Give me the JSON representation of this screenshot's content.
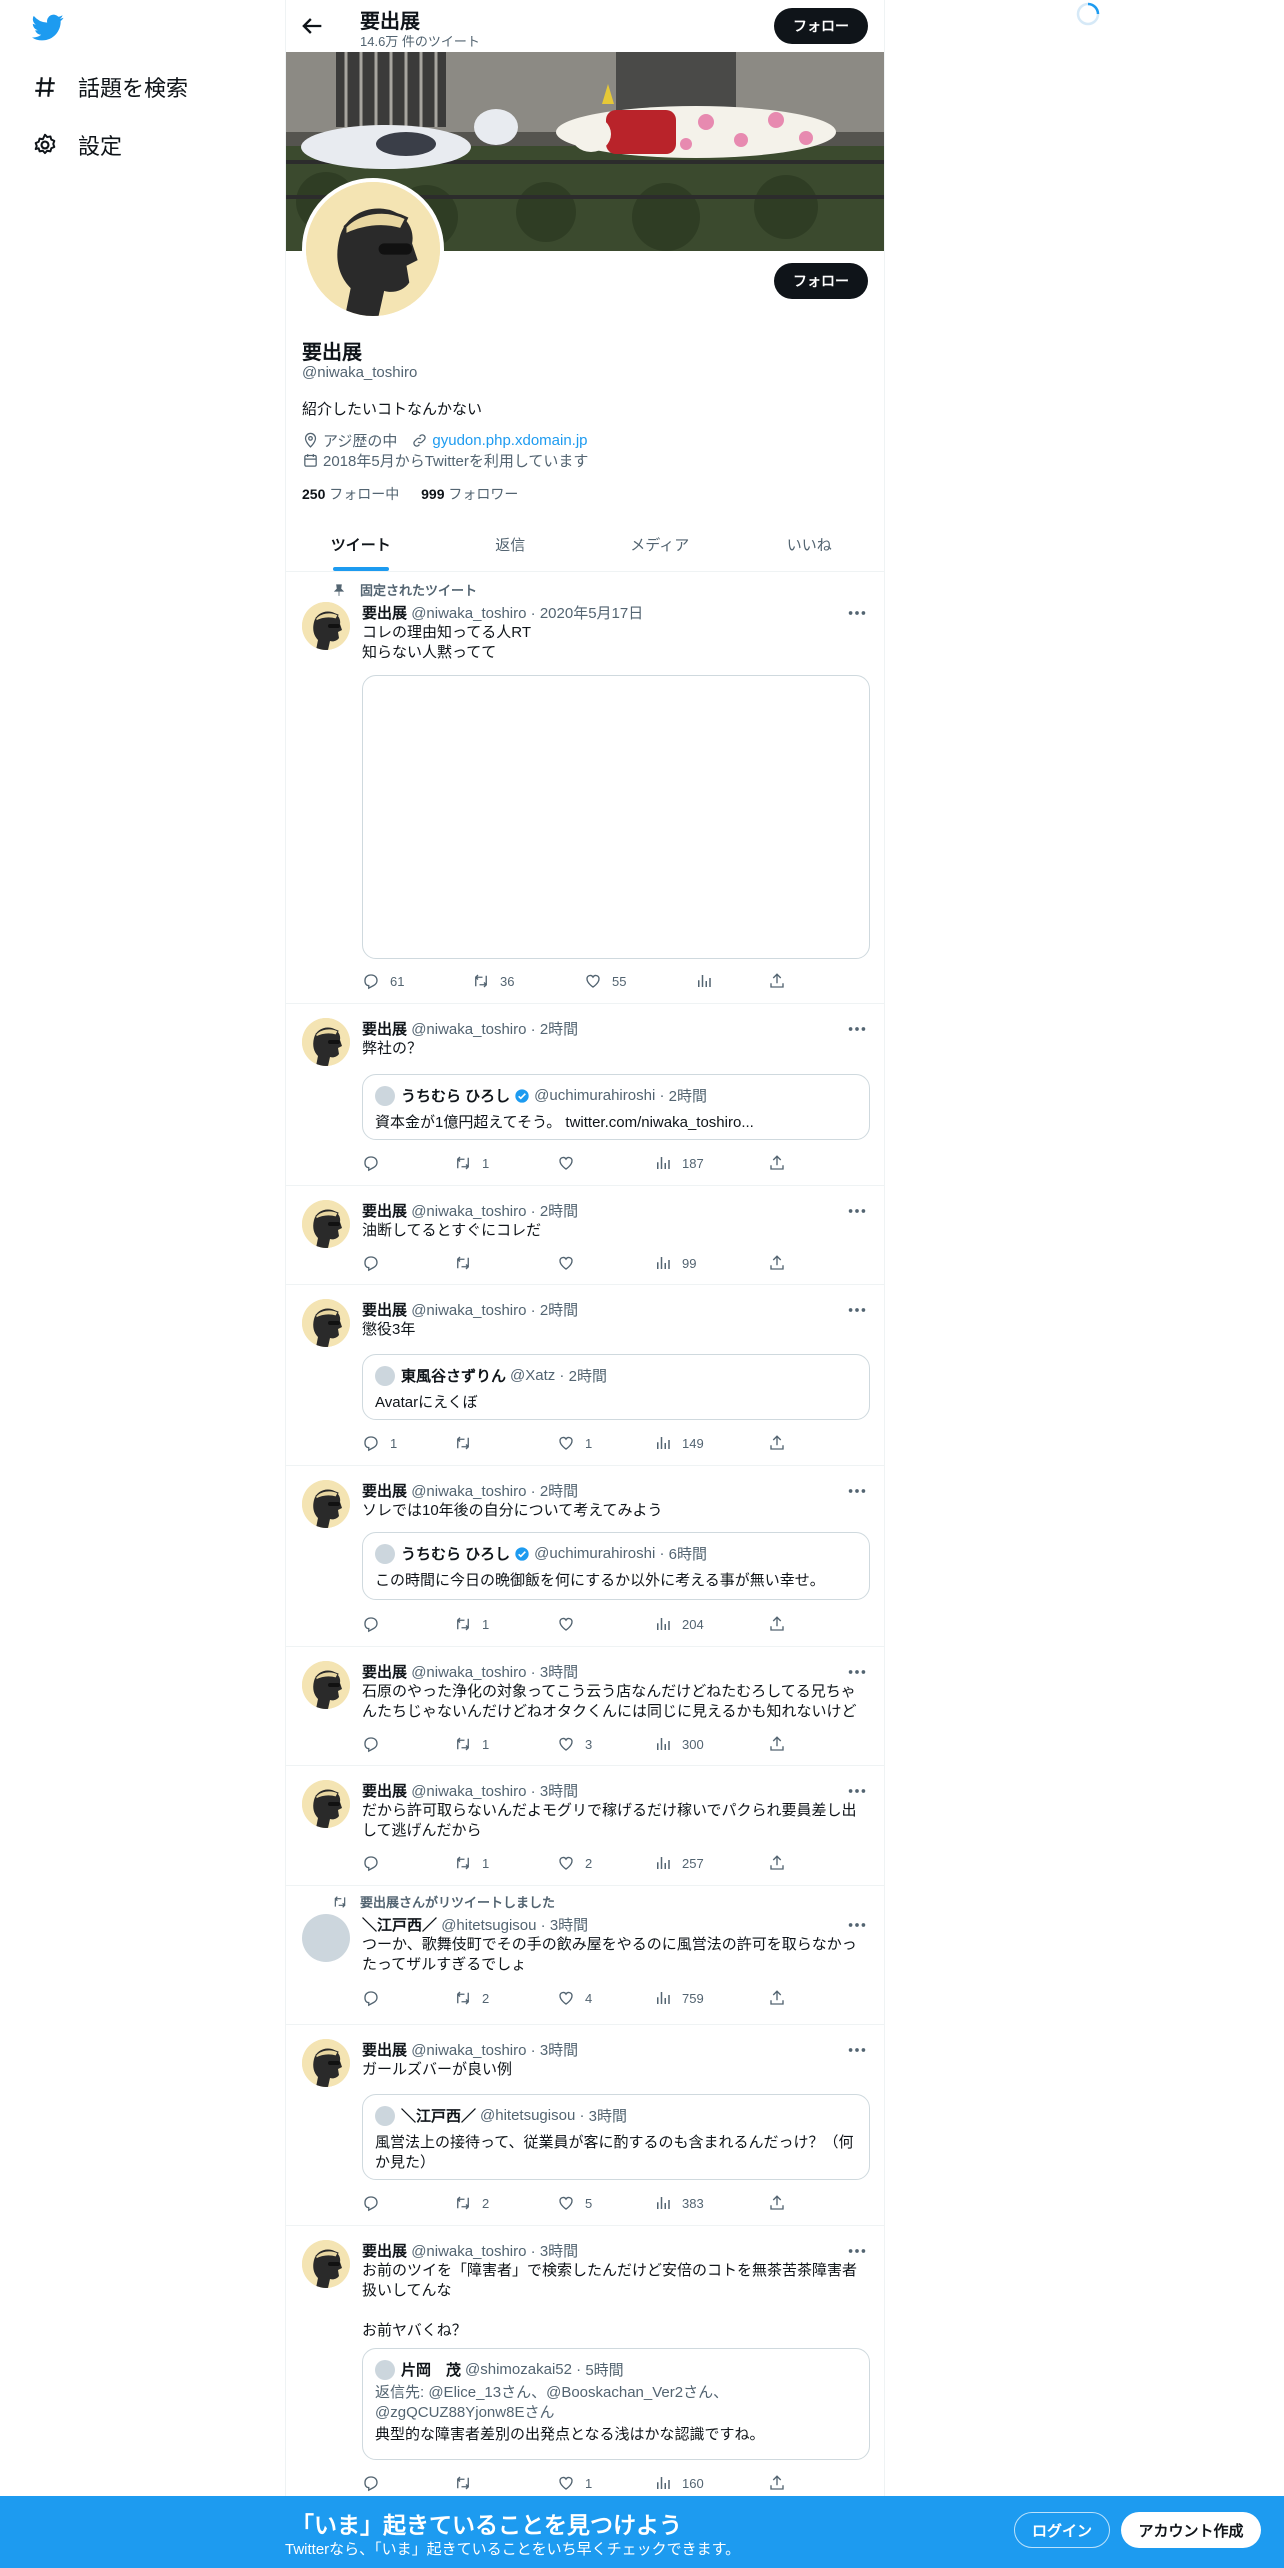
{
  "sidebar": {
    "items": [
      {
        "label": "話題を検索",
        "icon": "hashtag-icon"
      },
      {
        "label": "設定",
        "icon": "gear-icon"
      }
    ]
  },
  "header": {
    "name": "要出展",
    "tweet_count": "14.6万 件のツイート",
    "follow_label": "フォロー"
  },
  "profile": {
    "name": "要出展",
    "handle": "@niwaka_toshiro",
    "bio": "紹介したいコトなんかない",
    "location": "アジ歴の中",
    "website": "gyudon.php.xdomain.jp",
    "joined": "2018年5月からTwitterを利用しています",
    "following_count": "250",
    "following_label": "フォロー中",
    "followers_count": "999",
    "followers_label": "フォロワー",
    "follow_label": "フォロー"
  },
  "tabs": [
    {
      "label": "ツイート",
      "active": true
    },
    {
      "label": "返信",
      "active": false
    },
    {
      "label": "メディア",
      "active": false
    },
    {
      "label": "いいね",
      "active": false
    }
  ],
  "tweets": [
    {
      "pinned_label": "固定されたツイート",
      "name": "要出展",
      "handle": "@niwaka_toshiro",
      "time": "2020年5月17日",
      "lines": [
        "コレの理由知ってる人RT",
        "知らない人黙ってて"
      ],
      "reply": "61",
      "retweet": "36",
      "like": "55",
      "views": ""
    },
    {
      "name": "要出展",
      "handle": "@niwaka_toshiro",
      "time": "2時間",
      "lines": [
        "弊社の？"
      ],
      "quote": {
        "name": "うちむら ひろし",
        "handle": "@uchimurahiroshi",
        "time": "2時間",
        "lines": [
          "資本金が1億円超えてそう。 twitter.com/niwaka_toshiro..."
        ]
      },
      "reply": "",
      "retweet": "1",
      "like": "",
      "views": "187"
    },
    {
      "name": "要出展",
      "handle": "@niwaka_toshiro",
      "time": "2時間",
      "lines": [
        "油断してるとすぐにコレだ"
      ],
      "reply": "",
      "retweet": "",
      "like": "",
      "views": "99"
    },
    {
      "name": "要出展",
      "handle": "@niwaka_toshiro",
      "time": "2時間",
      "lines": [
        "懲役3年"
      ],
      "quote": {
        "name": "東風谷さずりん",
        "handle": "@Xatz",
        "time": "2時間",
        "lines": [
          "Avatarにえくぼ"
        ]
      },
      "reply": "1",
      "retweet": "",
      "like": "1",
      "views": "149"
    },
    {
      "name": "要出展",
      "handle": "@niwaka_toshiro",
      "time": "2時間",
      "lines": [
        "ソレでは10年後の自分について考えてみよう"
      ],
      "quote": {
        "name": "うちむら ひろし",
        "handle": "@uchimurahiroshi",
        "time": "6時間",
        "lines": [
          "この時間に今日の晩御飯を何にするか以外に考える事が無い幸せ。"
        ]
      },
      "reply": "",
      "retweet": "1",
      "like": "",
      "views": "204"
    },
    {
      "name": "要出展",
      "handle": "@niwaka_toshiro",
      "time": "3時間",
      "lines": [
        "石原のやった浄化の対象ってこう云う店なんだけどねたむろしてる兄ちゃ",
        "んたちじゃないんだけどねオタクくんには同じに見えるかも知れないけど"
      ],
      "reply": "",
      "retweet": "1",
      "like": "3",
      "views": "300"
    },
    {
      "name": "要出展",
      "handle": "@niwaka_toshiro",
      "time": "3時間",
      "lines": [
        "だから許可取らないんだよモグリで稼げるだけ稼いでパクられ要員差し出",
        "して逃げんだから"
      ],
      "reply": "",
      "retweet": "1",
      "like": "2",
      "views": "257"
    },
    {
      "retweeted_label": "要出展さんがリツイートしました",
      "name": "＼江戸西／",
      "handle": "@hitetsugisou",
      "time": "3時間",
      "lines": [
        "つーか、歌舞伎町でその手の飲み屋をやるのに風営法の許可を取らなかっ",
        "たってザルすぎるでしょ"
      ],
      "reply": "",
      "retweet": "2",
      "like": "4",
      "views": "759"
    },
    {
      "name": "要出展",
      "handle": "@niwaka_toshiro",
      "time": "3時間",
      "lines": [
        "ガールズバーが良い例"
      ],
      "quote": {
        "name": "＼江戸西／",
        "handle": "@hitetsugisou",
        "time": "3時間",
        "lines": [
          "風営法上の接待って、従業員が客に酌するのも含まれるんだっけ？（何",
          "か見た）"
        ]
      },
      "reply": "",
      "retweet": "2",
      "like": "5",
      "views": "383"
    },
    {
      "name": "要出展",
      "handle": "@niwaka_toshiro",
      "time": "3時間",
      "lines": [
        "お前のツイを「障害者」で検索したんだけど安倍のコトを無茶苦茶障害者",
        "扱いしてんな",
        "",
        "お前ヤバくね？"
      ],
      "quote": {
        "name": "片岡　茂",
        "handle": "@shimozakai52",
        "time": "5時間",
        "reply_to": [
          "返信先: @Elice_13さん、@Booskachan_Ver2さん、",
          "@zgQCUZ88Yjonw8Eさん"
        ],
        "lines": [
          "典型的な障害者差別の出発点となる浅はかな認識ですね。"
        ]
      },
      "reply": "",
      "retweet": "",
      "like": "1",
      "views": "160"
    }
  ],
  "bottom_bar": {
    "title": "「いま」起きていることを見つけよう",
    "subtitle": "Twitterなら、「いま」起きていることをいち早くチェックできます。",
    "login_label": "ログイン",
    "signup_label": "アカウント作成"
  },
  "colors": {
    "accent": "#1d9bf0",
    "text": "#0f1419",
    "muted": "#536471",
    "border": "#eff3f4"
  }
}
